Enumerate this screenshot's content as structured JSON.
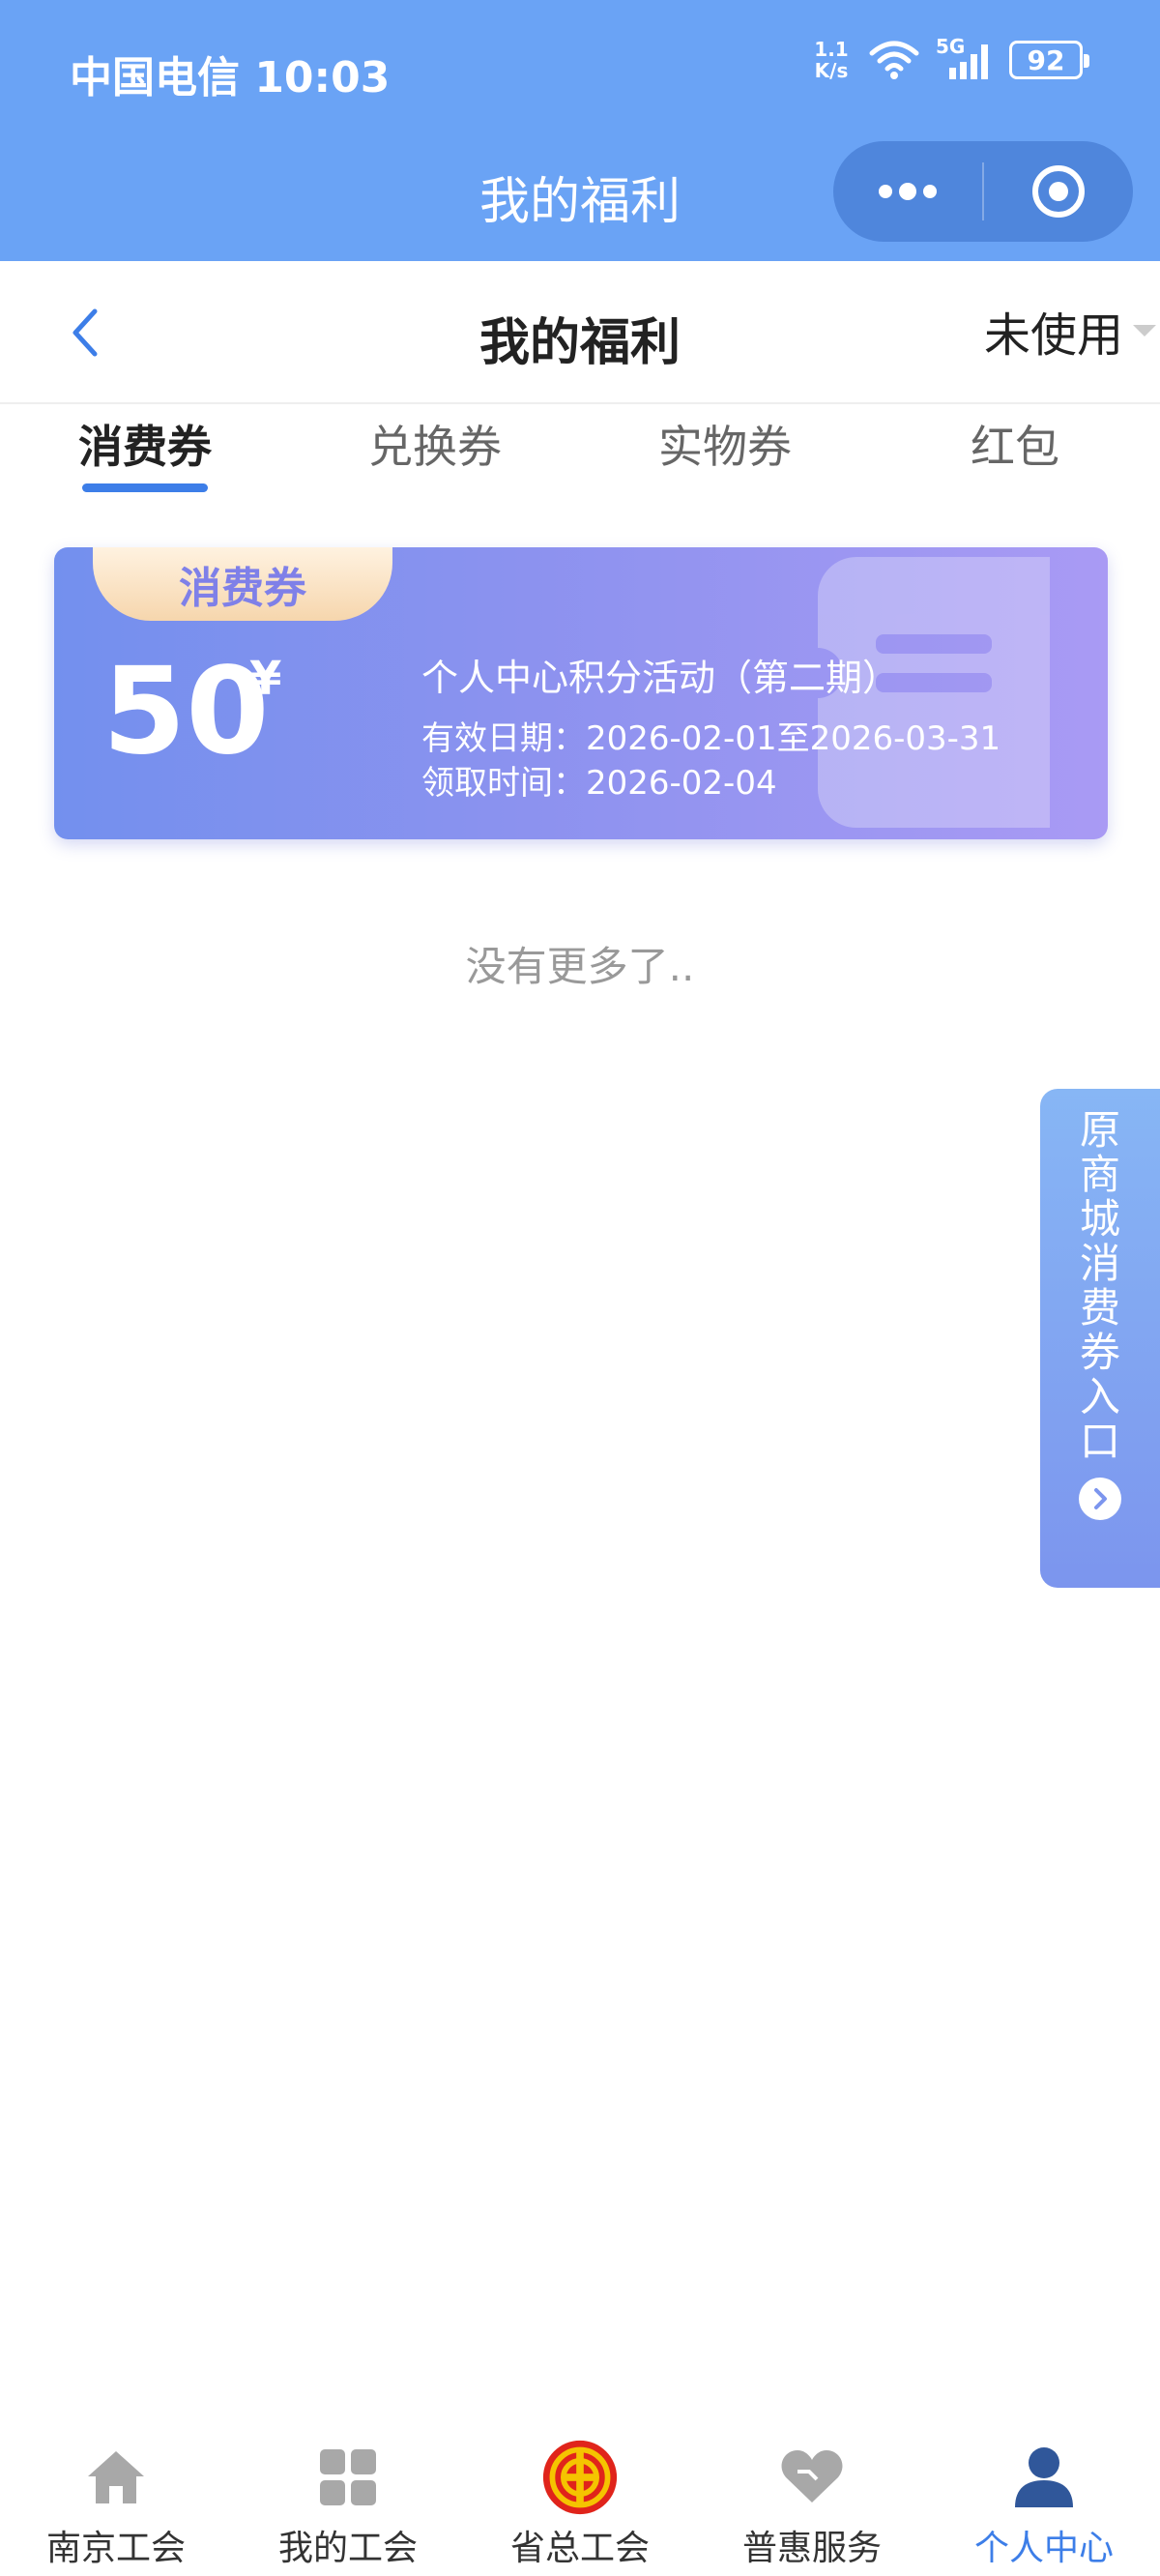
{
  "status_bar": {
    "carrier_time": "中国电信 10:03",
    "net_speed_top": "1.1",
    "net_speed_bottom": "K/s",
    "network": "5G",
    "battery": "92"
  },
  "mini_program": {
    "title": "我的福利"
  },
  "header": {
    "title": "我的福利",
    "filter_label": "未使用"
  },
  "tabs": [
    {
      "label": "消费券",
      "active": true
    },
    {
      "label": "兑换券",
      "active": false
    },
    {
      "label": "实物券",
      "active": false
    },
    {
      "label": "红包",
      "active": false
    }
  ],
  "coupon": {
    "badge": "消费券",
    "amount": "50",
    "currency": "¥",
    "name": "个人中心积分活动（第二期）",
    "valid_period": "有效日期：2026-02-01至2026-03-31",
    "claim_time": "领取时间：2026-02-04"
  },
  "list_end_text": "没有更多了..",
  "side_entry": {
    "label": "原商城消费券入口"
  },
  "tabbar": {
    "items": [
      {
        "label": "南京工会",
        "icon": "home-icon"
      },
      {
        "label": "我的工会",
        "icon": "grid-icon"
      },
      {
        "label": "省总工会",
        "icon": "union-emblem-icon"
      },
      {
        "label": "普惠服务",
        "icon": "heart-icon"
      },
      {
        "label": "个人中心",
        "icon": "person-icon"
      }
    ],
    "active_index": 4
  },
  "colors": {
    "brand_blue": "#6aa3f5",
    "tab_active": "#3d7ee8",
    "coupon_gradient_start": "#7390ee",
    "coupon_gradient_end": "#a99af4"
  }
}
